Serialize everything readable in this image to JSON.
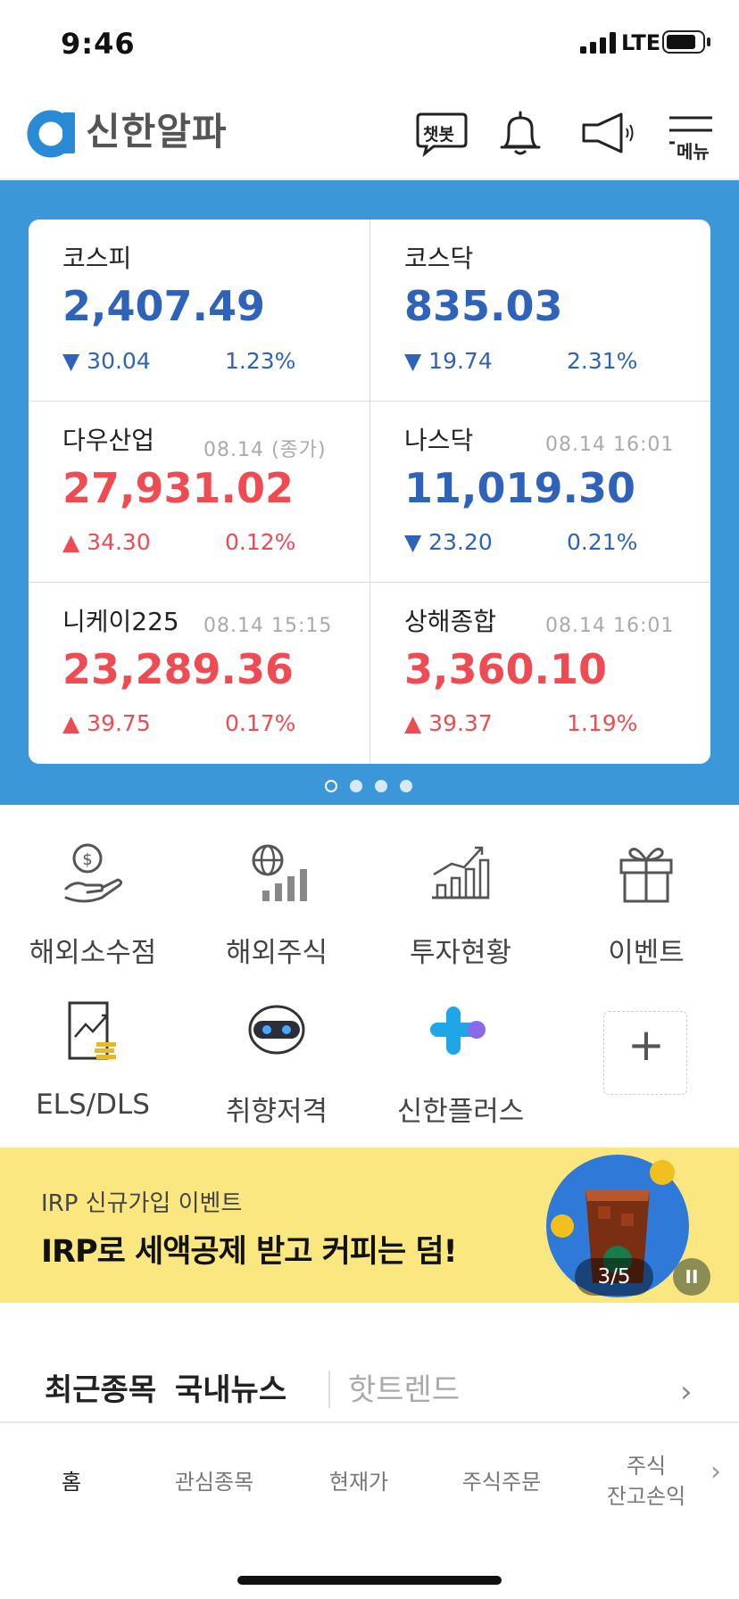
{
  "status_bar": {
    "time": "9:46",
    "network": "LTE"
  },
  "header": {
    "logo_text": "신한알파",
    "chatbot_label": "챗봇",
    "menu_label": "메뉴"
  },
  "market": {
    "cards": [
      {
        "name": "코스피",
        "meta": "",
        "value": "2,407.49",
        "change": "▼ 30.04",
        "percent": "1.23%",
        "direction": "down"
      },
      {
        "name": "코스닥",
        "meta": "",
        "value": "835.03",
        "change": "▼ 19.74",
        "percent": "2.31%",
        "direction": "down"
      },
      {
        "name": "다우산업",
        "meta": "08.14 (종가)",
        "value": "27,931.02",
        "change": "▲ 34.30",
        "percent": "0.12%",
        "direction": "up"
      },
      {
        "name": "나스닥",
        "meta": "08.14 16:01",
        "value": "11,019.30",
        "change": "▼ 23.20",
        "percent": "0.21%",
        "direction": "down"
      },
      {
        "name": "니케이225",
        "meta": "08.14 15:15",
        "value": "23,289.36",
        "change": "▲ 39.75",
        "percent": "0.17%",
        "direction": "up"
      },
      {
        "name": "상해종합",
        "meta": "08.14 16:01",
        "value": "3,360.10",
        "change": "▲ 39.37",
        "percent": "1.19%",
        "direction": "up"
      }
    ],
    "pages": 4,
    "active_page": 1
  },
  "quick_menu": [
    {
      "label": "해외소수점",
      "icon": "dollar-hand-icon"
    },
    {
      "label": "해외주식",
      "icon": "globe-chart-icon"
    },
    {
      "label": "투자현황",
      "icon": "growth-chart-icon"
    },
    {
      "label": "이벤트",
      "icon": "gift-icon"
    },
    {
      "label": "ELS/DLS",
      "icon": "document-coins-icon"
    },
    {
      "label": "취향저격",
      "icon": "robot-icon"
    },
    {
      "label": "신한플러스",
      "icon": "shinhan-plus-icon"
    }
  ],
  "add_tile": {
    "label": "+"
  },
  "banner": {
    "subtitle": "IRP 신규가입 이벤트",
    "title": "IRP로 세액공제 받고 커피는 덤!",
    "counter": "3/5",
    "pause": "II"
  },
  "news_tabs": {
    "tab1": "최근종목",
    "tab2": "국내뉴스",
    "tab3": "핫트렌드",
    "arrow": "›"
  },
  "bottom_nav": [
    {
      "label": "홈"
    },
    {
      "label": "관심종목"
    },
    {
      "label": "현재가"
    },
    {
      "label": "주식주문"
    },
    {
      "label": "주식\n잔고손익"
    }
  ],
  "bottom_nav_arrow": "›",
  "colors": {
    "up": "#ee4b53",
    "down": "#2f63b9",
    "panel": "#3b97d8",
    "banner": "#fbe77f"
  }
}
